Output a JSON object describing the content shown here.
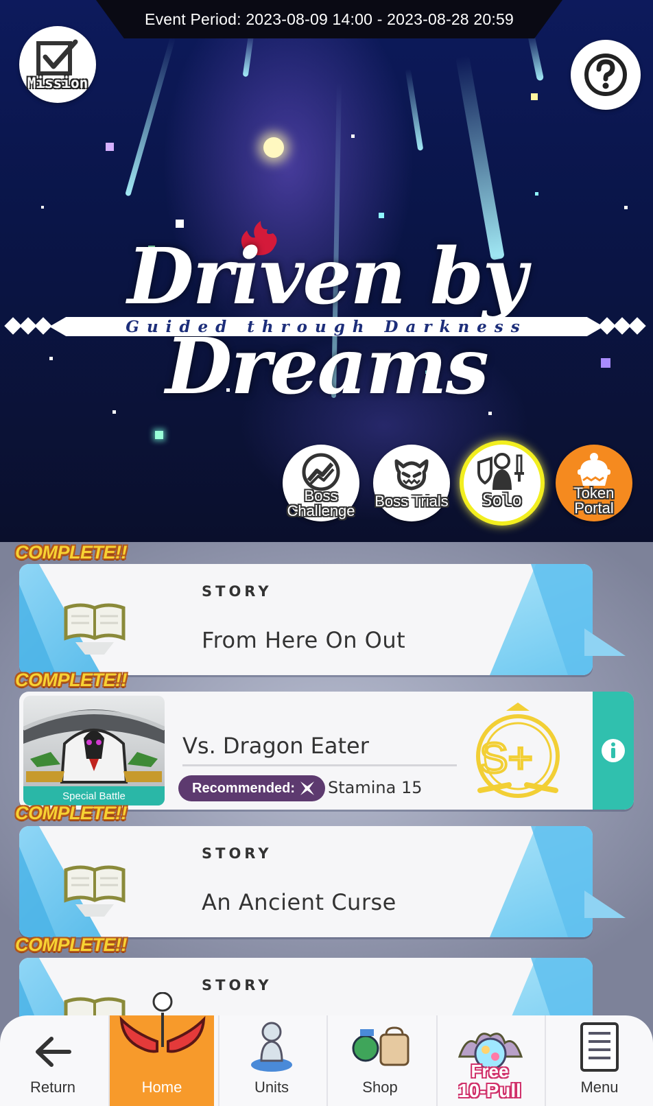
{
  "event": {
    "period_text": "Event Period: 2023-08-09 14:00 - 2023-08-28 20:59"
  },
  "top_buttons": {
    "mission_label": "Mission",
    "help_icon": "question-icon"
  },
  "banner": {
    "title": "Driven by Dreams",
    "subtitle": "Guided through Darkness"
  },
  "modes": [
    {
      "label_line1": "Boss",
      "label_line2": "Challenge",
      "icon": "boss-challenge-icon"
    },
    {
      "label": "Boss Trials",
      "icon": "demon-face-icon"
    },
    {
      "label": "Solo",
      "icon": "solo-knight-icon",
      "highlighted": true
    },
    {
      "label_line1": "Token",
      "label_line2": "Portal",
      "icon": "token-pot-icon",
      "color": "#f58a1f"
    }
  ],
  "quests": [
    {
      "badge": "COMPLETE!!",
      "kicker": "STORY",
      "title": "From Here On Out"
    },
    {
      "badge": "COMPLETE!!",
      "title": "Vs. Dragon Eater",
      "thumb_caption": "Special Battle",
      "recommended_label": "Recommended:",
      "stamina": "Stamina 15",
      "rank": "S+"
    },
    {
      "badge": "COMPLETE!!",
      "kicker": "STORY",
      "title": "An Ancient Curse"
    },
    {
      "badge": "COMPLETE!!",
      "kicker": "STORY",
      "title": ""
    }
  ],
  "nav": {
    "return_label": "Return",
    "home_label": "Home",
    "units_label": "Units",
    "shop_label": "Shop",
    "free_line1": "Free",
    "free_line2": "10-Pull",
    "menu_label": "Menu"
  },
  "colors": {
    "accent_orange": "#f79a2b",
    "info_teal": "#30c0ae",
    "complete_yellow": "#f7d233",
    "story_blue": "#5cbdeb"
  }
}
